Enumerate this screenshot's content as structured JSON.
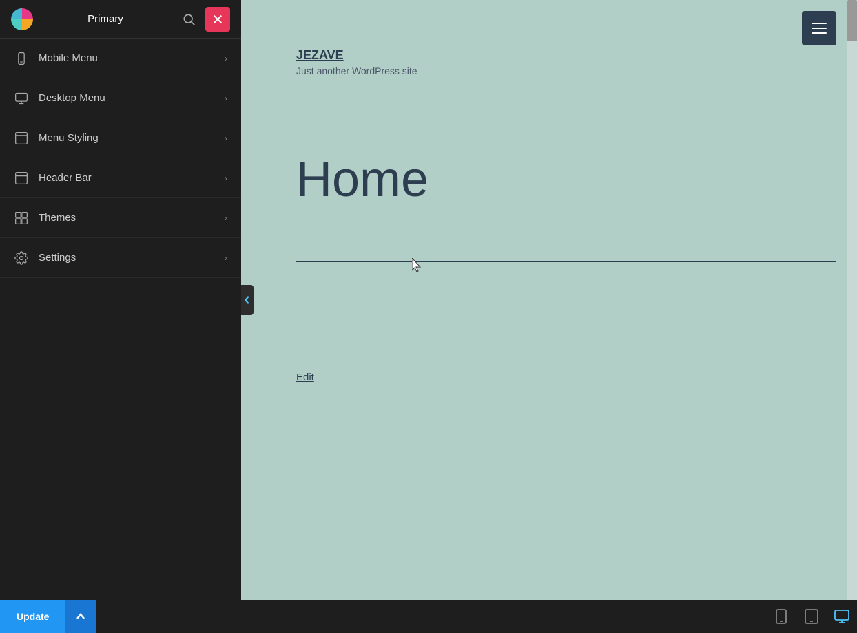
{
  "sidebar": {
    "title": "Primary",
    "logo_alt": "app-logo",
    "nav_items": [
      {
        "id": "mobile-menu",
        "label": "Mobile Menu",
        "icon": "mobile-icon"
      },
      {
        "id": "desktop-menu",
        "label": "Desktop Menu",
        "icon": "desktop-icon"
      },
      {
        "id": "menu-styling",
        "label": "Menu Styling",
        "icon": "styling-icon"
      },
      {
        "id": "header-bar",
        "label": "Header Bar",
        "icon": "header-icon"
      },
      {
        "id": "themes",
        "label": "Themes",
        "icon": "themes-icon"
      },
      {
        "id": "settings",
        "label": "Settings",
        "icon": "settings-icon"
      }
    ]
  },
  "preview": {
    "site_name": "JEZAVE",
    "site_tagline": "Just another WordPress site",
    "page_title": "Home",
    "edit_label": "Edit"
  },
  "toolbar": {
    "update_label": "Update",
    "up_arrow": "▲"
  },
  "colors": {
    "accent_blue": "#2196f3",
    "close_btn_red": "#e6365a",
    "sidebar_bg": "#1e1e1e",
    "preview_bg": "#b2cfc7"
  }
}
